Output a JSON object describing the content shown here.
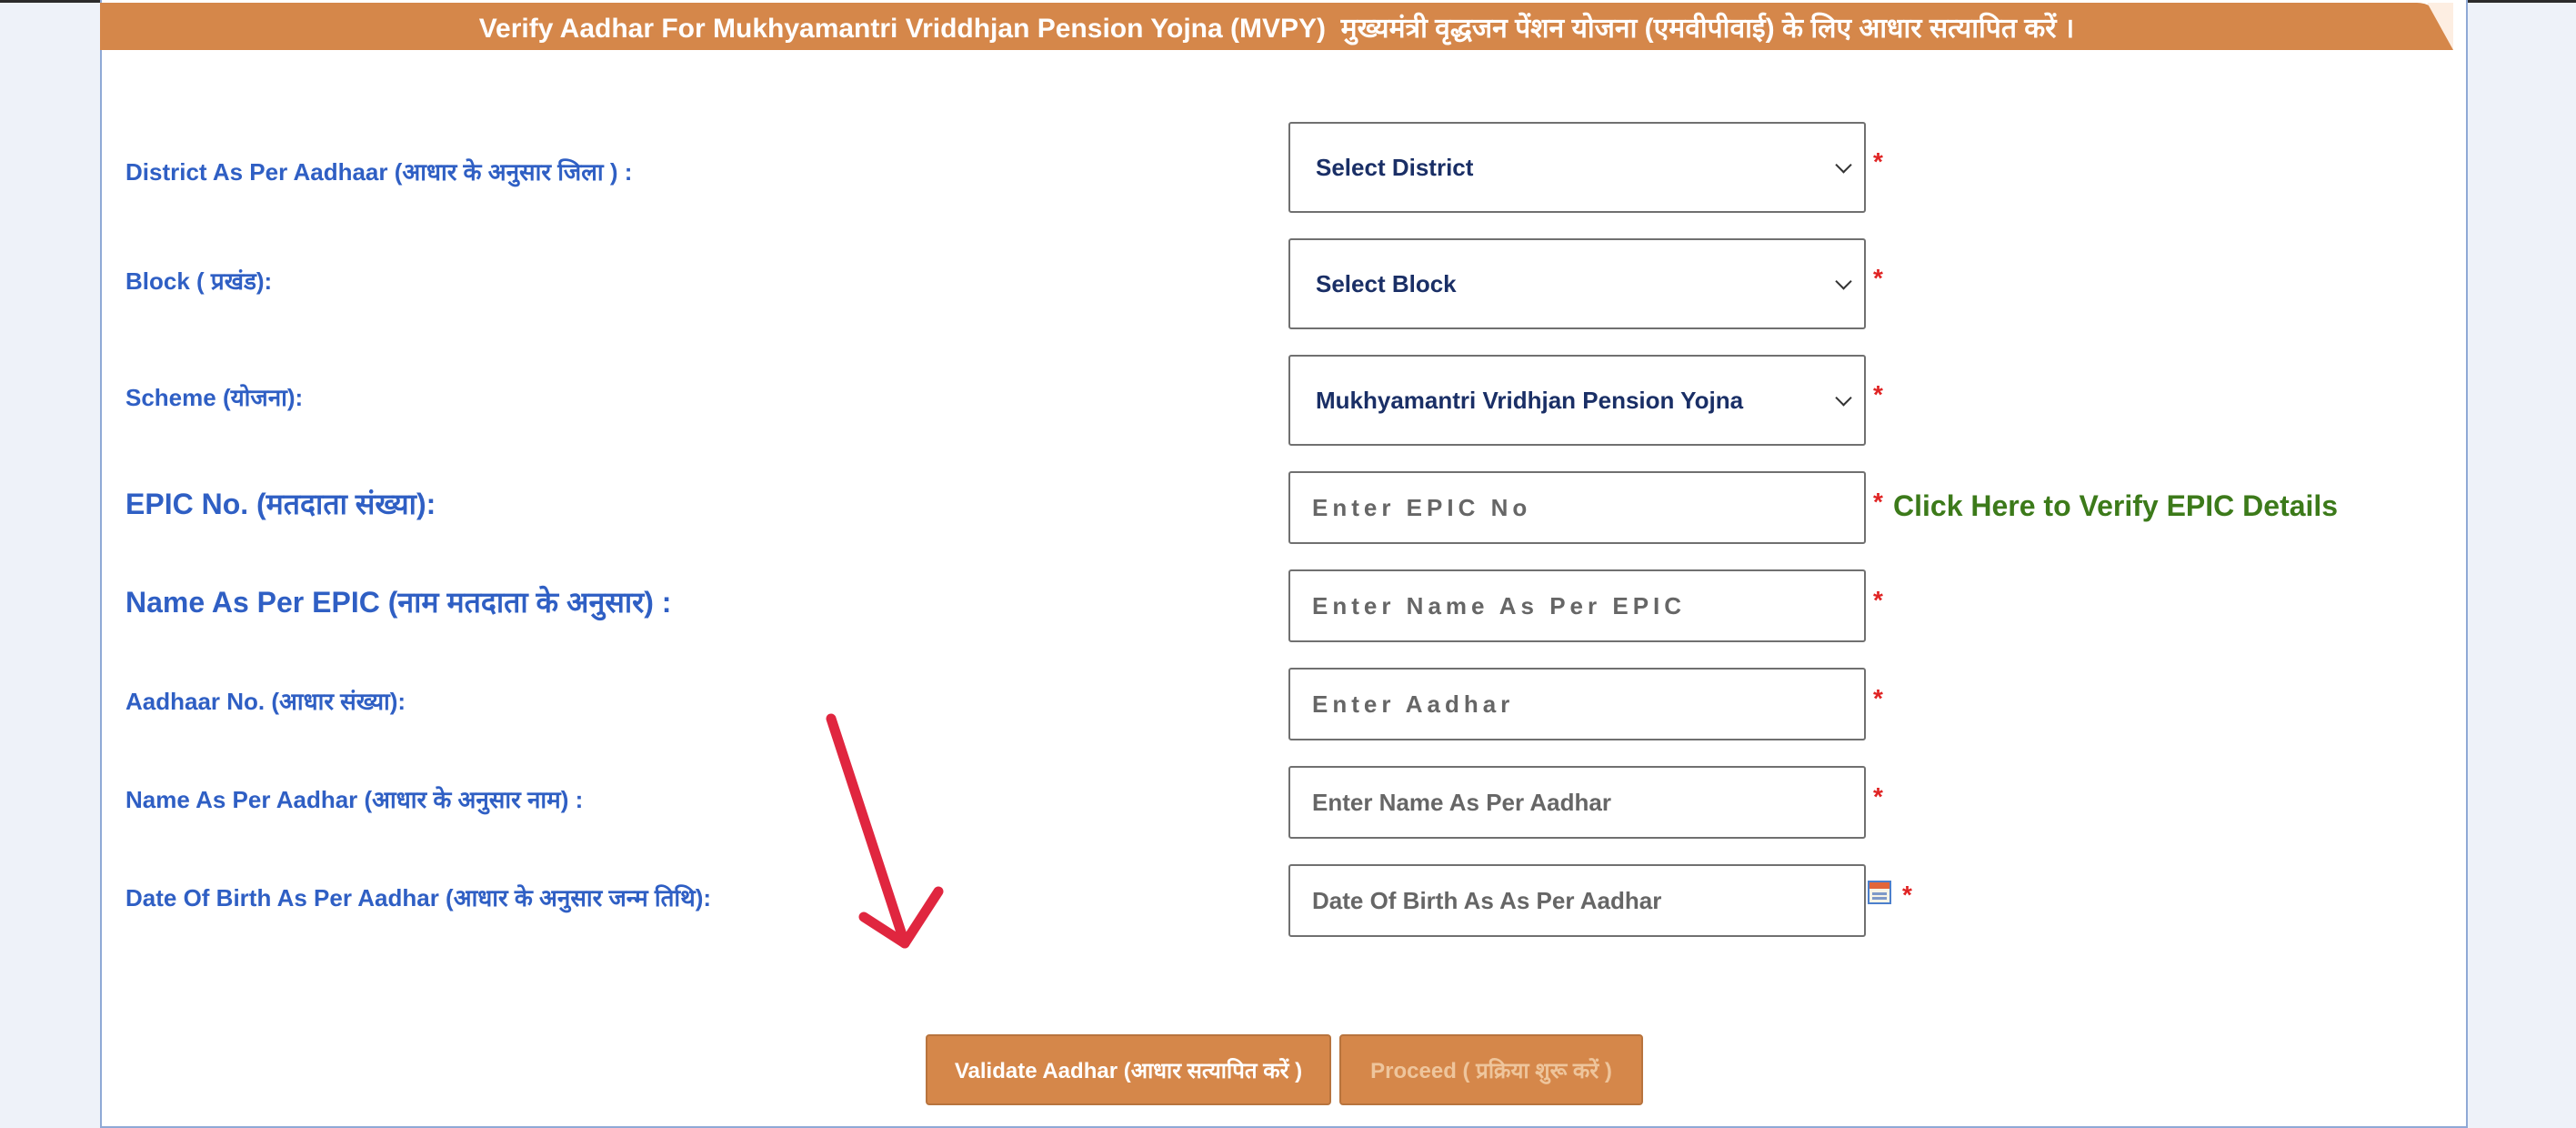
{
  "header": {
    "title": "Verify Aadhar For Mukhyamantri Vriddhjan Pension Yojna (MVPY)  मुख्यमंत्री वृद्धजन पेंशन योजना (एमवीपीवाई) के लिए आधार सत्यापित करें ।"
  },
  "form": {
    "district": {
      "label": "District As Per Aadhaar (आधार के अनुसार जिला ) :",
      "selected": "Select District"
    },
    "block": {
      "label": "Block ( प्रखंड):",
      "selected": "Select Block"
    },
    "scheme": {
      "label": "Scheme (योजना):",
      "selected": "Mukhyamantri Vridhjan Pension Yojna"
    },
    "epic_no": {
      "label": "EPIC No. (मतदाता संख्या):",
      "placeholder": "Enter EPIC No"
    },
    "epic_name": {
      "label": "Name As Per EPIC (नाम मतदाता के अनुसार) :",
      "placeholder": "Enter Name As Per EPIC"
    },
    "aadhaar_no": {
      "label": "Aadhaar No. (आधार संख्या):",
      "placeholder": "Enter Aadhar"
    },
    "aadhaar_name": {
      "label": "Name As Per Aadhar (आधार के अनुसार नाम) :",
      "placeholder": "Enter Name As Per Aadhar"
    },
    "dob": {
      "label": "Date Of Birth As Per Aadhar (आधार के अनुसार जन्म तिथि):",
      "placeholder": "Date Of Birth As As Per Aadhar"
    },
    "required_mark": "*",
    "epic_verify_link": "Click Here to Verify EPIC Details"
  },
  "buttons": {
    "validate": "Validate Aadhar (आधार सत्यापित करें )",
    "proceed": "Proceed ( प्रक्रिया शुरू  करें )"
  },
  "icons": {
    "calendar": "calendar-icon",
    "dropdown": "chevron-down-icon",
    "annotation": "red-arrow-annotation"
  },
  "colors": {
    "header_bg": "#d5874a",
    "label": "#2f5fc4",
    "required": "#e02424",
    "link": "#3c7a1a",
    "annotation_arrow": "#e0263f"
  }
}
